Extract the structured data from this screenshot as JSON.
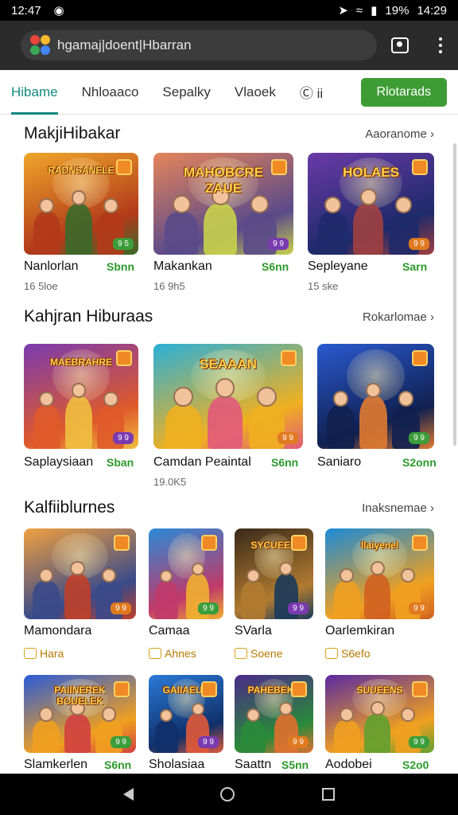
{
  "status_bar": {
    "time": "12:47",
    "battery": "19%",
    "clock_right": "14:29"
  },
  "browser": {
    "url": "hgamaj|doent|Hbarran",
    "tabs_icon": "tab-switcher-icon",
    "menu_icon": "more-vert-icon"
  },
  "tabs": {
    "items": [
      "Hibame",
      "Nhloaaco",
      "Sepalky",
      "Vlaoek",
      "Ⓒ ii"
    ],
    "active": 0,
    "button": "Rlotarads"
  },
  "sections": [
    {
      "title": "MakjiHibakar",
      "more": "Aaoranome ›",
      "cards": [
        {
          "name": "Nanlorlan",
          "price": "Sbnn",
          "sub": "16 5loe",
          "badge": "9 5",
          "logo": "RADNSANELE",
          "palette": [
            "#f0a62b",
            "#b23a1a",
            "#3a6a2a"
          ]
        },
        {
          "name": "Makankan",
          "price": "S6nn",
          "sub": "16 9h5",
          "badge": "9 9",
          "logo": "MAHOBCRE ZAUE",
          "palette": [
            "#e6845a",
            "#5a4a8a",
            "#c8d14a"
          ]
        },
        {
          "name": "Sepleyane",
          "price": "Sarn",
          "sub": "15 ske",
          "badge": "9 9",
          "logo": "HOLAES",
          "palette": [
            "#6a3aa8",
            "#1e2a6a",
            "#a04040"
          ]
        }
      ]
    },
    {
      "title": "Kahjran Hiburaas",
      "more": "Rokarlomae ›",
      "cards": [
        {
          "name": "Saplaysiaan",
          "price": "Sban",
          "sub": "",
          "badge": "9 9",
          "logo": "MAEBRAHRE",
          "palette": [
            "#7a3ab0",
            "#e05a2a",
            "#f0c040"
          ]
        },
        {
          "name": "Camdan Peaintal",
          "price": "S6nn",
          "sub": "19.0K5",
          "badge": "9 9",
          "logo": "SEAAAN",
          "palette": [
            "#2ab0d8",
            "#f0b020",
            "#e05a7a"
          ]
        },
        {
          "name": "Saniaro",
          "price": "S2onn",
          "sub": "",
          "badge": "9 9",
          "logo": "",
          "palette": [
            "#2a5ad0",
            "#102050",
            "#e07a30"
          ]
        }
      ]
    },
    {
      "title": "Kalfiiblurnes",
      "more": "Inaksnemae ›",
      "cards": [
        {
          "name": "Mamondara",
          "rating": "Hara",
          "badge": "9 9",
          "logo": "",
          "palette": [
            "#f0a040",
            "#3a4a8a",
            "#c0402a"
          ]
        },
        {
          "name": "Camaa",
          "rating": "Ahnes",
          "badge": "9 9",
          "logo": "",
          "palette": [
            "#2a8ad8",
            "#c03a6a",
            "#f0b030"
          ]
        },
        {
          "name": "SVarla",
          "rating": "Soene",
          "badge": "9 9",
          "logo": "SYCUEEK",
          "palette": [
            "#3a2a1a",
            "#b07a30",
            "#1a3a5a"
          ]
        },
        {
          "name": "Oarlemkiran",
          "rating": "S6efo",
          "badge": "9 9",
          "logo": "Ilaiyenel",
          "palette": [
            "#1a8ad8",
            "#f0a020",
            "#d06020"
          ]
        }
      ]
    },
    {
      "cards": [
        {
          "name": "Slamkerlen",
          "price": "S6nn",
          "badge": "9 9",
          "logo": "PAIINEREK BOUELEK",
          "palette": [
            "#2a5ad8",
            "#f0a020",
            "#d04040"
          ]
        },
        {
          "name": "Sholasiaa",
          "price": "",
          "badge": "9 9",
          "logo": "GAIIAEUN",
          "palette": [
            "#2a7ad8",
            "#10306a",
            "#e05a3a"
          ]
        },
        {
          "name": "Saattn",
          "price": "S5nn",
          "badge": "9 9",
          "logo": "PAHEBEKS",
          "palette": [
            "#4a2a8a",
            "#2a8a3a",
            "#e07030"
          ]
        },
        {
          "name": "Aodobei",
          "price": "S2o0",
          "badge": "9 9",
          "logo": "SUUEENS",
          "palette": [
            "#5a2aa0",
            "#f0a020",
            "#60a030"
          ]
        }
      ]
    }
  ]
}
